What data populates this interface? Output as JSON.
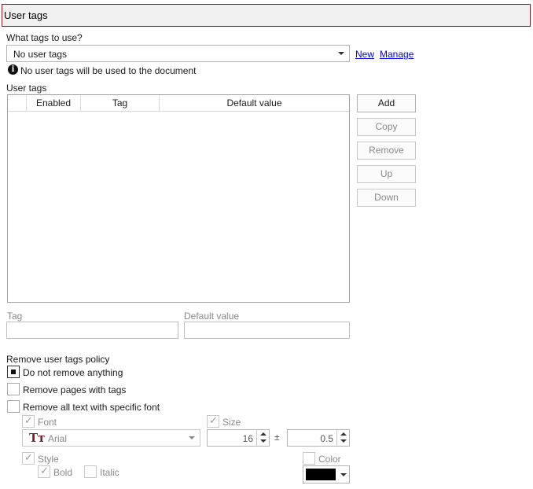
{
  "header": {
    "title": "User tags"
  },
  "tags_to_use": {
    "label": "What tags to use?",
    "selected": "No user tags",
    "new_link": "New",
    "manage_link": "Manage",
    "info_text": "No user tags will be used to the document"
  },
  "user_tags": {
    "label": "User tags",
    "columns": [
      "",
      "Enabled",
      "Tag",
      "Default value"
    ],
    "rows": []
  },
  "buttons": {
    "add": "Add",
    "copy": "Copy",
    "remove": "Remove",
    "up": "Up",
    "down": "Down"
  },
  "edit": {
    "tag_label": "Tag",
    "default_value_label": "Default value",
    "tag_value": "",
    "default_value": ""
  },
  "policy": {
    "label": "Remove user tags policy",
    "options": [
      "Do not remove anything",
      "Remove pages with tags",
      "Remove all text with specific font"
    ],
    "selected_index": 0
  },
  "font_filter": {
    "font_label": "Font",
    "font_checked": true,
    "font_value": "Arial",
    "font_icon": "truetype-font-icon",
    "size_label": "Size",
    "size_checked": true,
    "size_value": "16",
    "plusminus": "±",
    "tolerance_value": "0.5",
    "style_label": "Style",
    "style_checked": true,
    "bold_label": "Bold",
    "bold_checked": true,
    "italic_label": "Italic",
    "italic_checked": false,
    "color_label": "Color",
    "color_checked": false,
    "color_value": "#000000"
  },
  "colors": {
    "header_border": "#8a1a2a",
    "header_bg": "#f0f0f0",
    "link": "#0000ee",
    "disabled_text": "#8a8a8a"
  }
}
